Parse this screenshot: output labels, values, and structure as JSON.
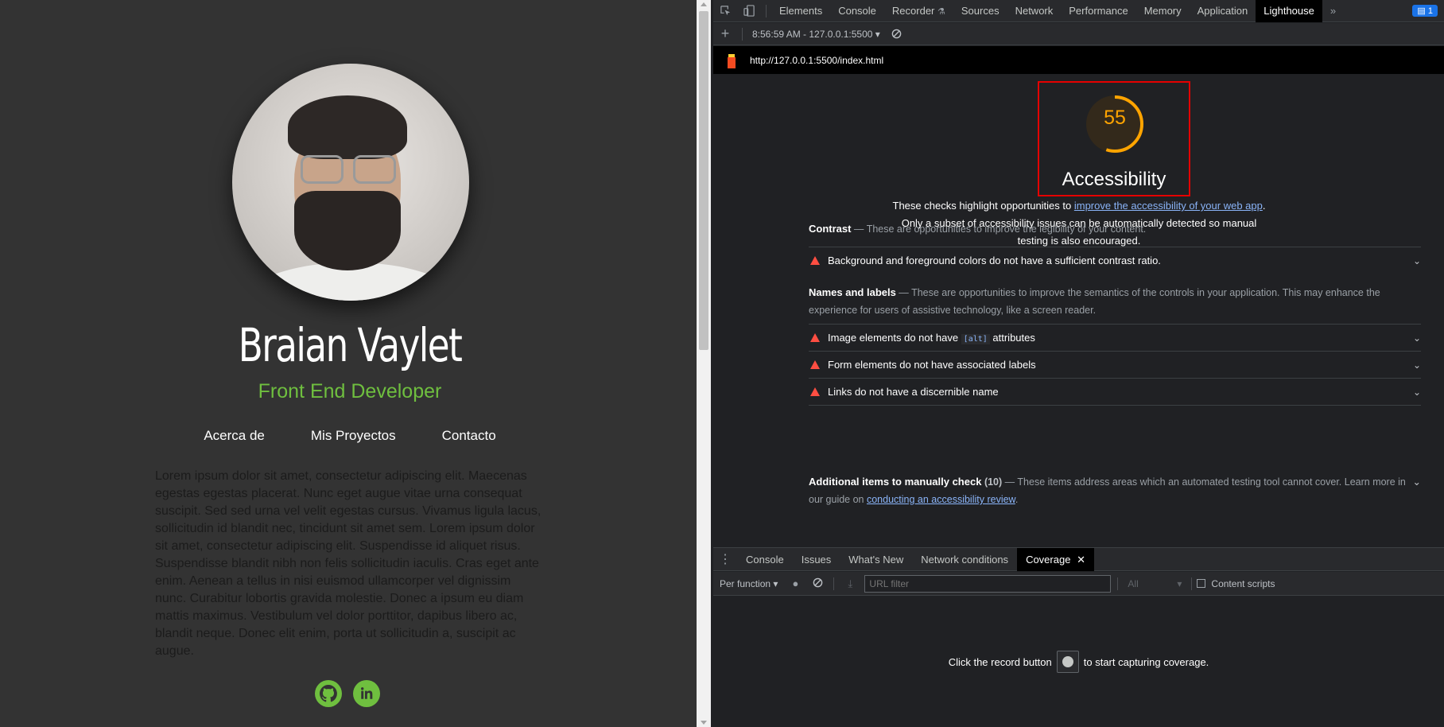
{
  "page": {
    "name": "Braian Vaylet",
    "role": "Front End Developer",
    "nav": [
      "Acerca de",
      "Mis Proyectos",
      "Contacto"
    ],
    "paragraph": "Lorem ipsum dolor sit amet, consectetur adipiscing elit. Maecenas egestas egestas placerat. Nunc eget augue vitae urna consequat suscipit. Sed sed urna vel velit egestas cursus. Vivamus ligula lacus, sollicitudin id blandit nec, tincidunt sit amet sem. Lorem ipsum dolor sit amet, consectetur adipiscing elit. Suspendisse id aliquet risus. Suspendisse blandit nibh non felis sollicitudin iaculis. Cras eget ante enim. Aenean a tellus in nisi euismod ullamcorper vel dignissim nunc. Curabitur lobortis gravida molestie. Donec a ipsum eu diam mattis maximus. Vestibulum vel dolor porttitor, dapibus libero ac, blandit neque. Donec elit enim, porta ut sollicitudin a, suscipit ac augue.",
    "socials": [
      "github-icon",
      "linkedin-icon"
    ],
    "colors": {
      "accent": "#6fbf3f",
      "background": "#333333"
    }
  },
  "devtools": {
    "tabs": [
      "Elements",
      "Console",
      "Recorder",
      "Sources",
      "Network",
      "Performance",
      "Memory",
      "Application",
      "Lighthouse"
    ],
    "active_tab": "Lighthouse",
    "issues_count": "1",
    "report_selector": "8:56:59 AM - 127.0.0.1:5500",
    "url": "http://127.0.0.1:5500/index.html",
    "score": "55",
    "score_fraction": 0.55,
    "score_color": "#ffa400",
    "category": "Accessibility",
    "description": {
      "before": "These checks highlight opportunities to ",
      "link": "improve the accessibility of your web app",
      "after": ". Only a subset of accessibility issues can be automatically detected so manual testing is also encouraged."
    },
    "contrast": {
      "title": "Contrast",
      "desc": "These are opportunities to improve the legibility of your content.",
      "audits": [
        "Background and foreground colors do not have a sufficient contrast ratio."
      ]
    },
    "names": {
      "title": "Names and labels",
      "desc": "These are opportunities to improve the semantics of the controls in your application. This may enhance the experience for users of assistive technology, like a screen reader.",
      "audit1_before": "Image elements do not have ",
      "audit1_code": "[alt]",
      "audit1_after": " attributes",
      "audit2": "Form elements do not have associated labels",
      "audit3": "Links do not have a discernible name"
    },
    "manual": {
      "title": "Additional items to manually check",
      "count": "(10)",
      "desc": "These items address areas which an automated testing tool cannot cover. Learn more in our guide on ",
      "link": "conducting an accessibility review",
      "end": "."
    },
    "drawer_tabs": [
      "Console",
      "Issues",
      "What's New",
      "Network conditions",
      "Coverage"
    ],
    "active_drawer_tab": "Coverage",
    "coverage": {
      "mode": "Per function",
      "filter_placeholder": "URL filter",
      "type": "All",
      "content_scripts": "Content scripts",
      "empty_before": "Click the record button",
      "empty_after": "to start capturing coverage."
    }
  }
}
